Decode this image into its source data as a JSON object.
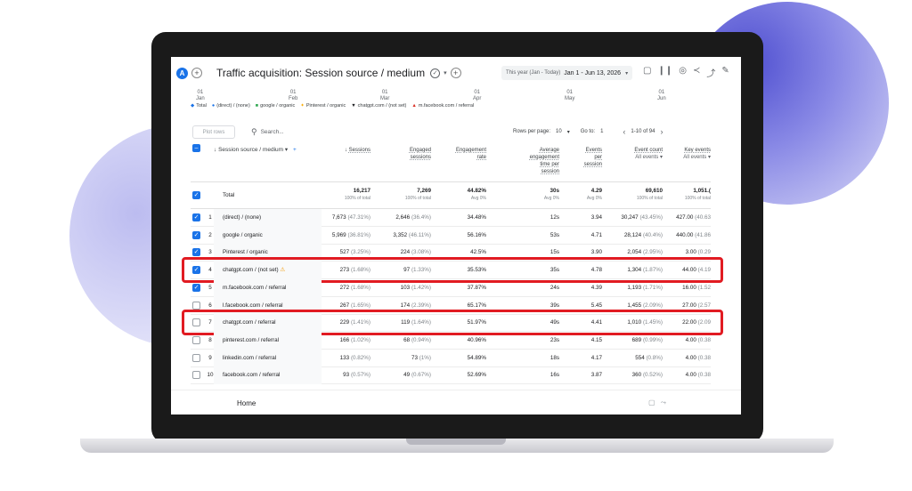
{
  "header": {
    "avatar_letter": "A",
    "add_label": "+",
    "title": "Traffic acquisition: Session source / medium",
    "date_range_label": "This year (Jan - Today)",
    "date_range_value": "Jan 1 - Jun 13, 2026"
  },
  "timeline": [
    {
      "day": "01",
      "month": "Jan"
    },
    {
      "day": "01",
      "month": "Feb"
    },
    {
      "day": "01",
      "month": "Mar"
    },
    {
      "day": "01",
      "month": "Apr"
    },
    {
      "day": "01",
      "month": "May"
    },
    {
      "day": "01",
      "month": "Jun"
    }
  ],
  "legend": [
    {
      "label": "Total",
      "color": "#1a73e8",
      "icon": "diamond"
    },
    {
      "label": "(direct) / (none)",
      "color": "#1a73e8",
      "icon": "dot"
    },
    {
      "label": "google / organic",
      "color": "#34a853",
      "icon": "square"
    },
    {
      "label": "Pinterest / organic",
      "color": "#f9ab00",
      "icon": "star"
    },
    {
      "label": "chatgpt.com / (not set)",
      "color": "#202124",
      "icon": "triangle-down"
    },
    {
      "label": "m.facebook.com / referral",
      "color": "#d93025",
      "icon": "triangle-up"
    }
  ],
  "toolbar": {
    "plot_rows": "Plot rows",
    "search_placeholder": "Search...",
    "rows_per_page_label": "Rows per page:",
    "rows_per_page_value": "10",
    "go_to_label": "Go to:",
    "go_to_value": "1",
    "page_range": "1-10 of 94"
  },
  "columns": {
    "dimension": "Session source / medium",
    "sessions": "Sessions",
    "engaged": [
      "Engaged",
      "sessions"
    ],
    "engagement_rate": [
      "Engagement",
      "rate"
    ],
    "avg_time": [
      "Average",
      "engagement",
      "time per",
      "session"
    ],
    "events_per": [
      "Events",
      "per",
      "session"
    ],
    "event_count": [
      "Event count",
      "All events"
    ],
    "key_events": [
      "Key events",
      "All events"
    ]
  },
  "totals": {
    "label": "Total",
    "sessions": "16,217",
    "sessions_sub": "100% of total",
    "engaged": "7,269",
    "engaged_sub": "100% of total",
    "rate": "44.82%",
    "rate_sub": "Avg 0%",
    "time": "30s",
    "time_sub": "Avg 0%",
    "events_per": "4.29",
    "events_per_sub": "Avg 0%",
    "event_count": "69,610",
    "event_count_sub": "100% of total",
    "key_events": "1,051.(",
    "key_events_sub": "100% of total"
  },
  "rows": [
    {
      "idx": "1",
      "checked": true,
      "source": "(direct) / (none)",
      "sessions": "7,673",
      "sessions_pct": "(47.31%)",
      "engaged": "2,646",
      "engaged_pct": "(36.4%)",
      "rate": "34.48%",
      "time": "12s",
      "events_per": "3.94",
      "event_count": "30,247",
      "event_pct": "(43.45%)",
      "key_events": "427.00",
      "key_pct": "(40.63"
    },
    {
      "idx": "2",
      "checked": true,
      "source": "google / organic",
      "sessions": "5,969",
      "sessions_pct": "(36.81%)",
      "engaged": "3,352",
      "engaged_pct": "(46.11%)",
      "rate": "56.16%",
      "time": "53s",
      "events_per": "4.71",
      "event_count": "28,124",
      "event_pct": "(40.4%)",
      "key_events": "440.00",
      "key_pct": "(41.86"
    },
    {
      "idx": "3",
      "checked": true,
      "source": "Pinterest / organic",
      "sessions": "527",
      "sessions_pct": "(3.25%)",
      "engaged": "224",
      "engaged_pct": "(3.08%)",
      "rate": "42.5%",
      "time": "15s",
      "events_per": "3.90",
      "event_count": "2,054",
      "event_pct": "(2.95%)",
      "key_events": "3.00",
      "key_pct": "(0.29"
    },
    {
      "idx": "4",
      "checked": true,
      "source": "chatgpt.com / (not set)",
      "warn": "⚠",
      "sessions": "273",
      "sessions_pct": "(1.68%)",
      "engaged": "97",
      "engaged_pct": "(1.33%)",
      "rate": "35.53%",
      "time": "35s",
      "events_per": "4.78",
      "event_count": "1,304",
      "event_pct": "(1.87%)",
      "key_events": "44.00",
      "key_pct": "(4.19"
    },
    {
      "idx": "5",
      "checked": true,
      "source": "m.facebook.com / referral",
      "sessions": "272",
      "sessions_pct": "(1.68%)",
      "engaged": "103",
      "engaged_pct": "(1.42%)",
      "rate": "37.87%",
      "time": "24s",
      "events_per": "4.39",
      "event_count": "1,193",
      "event_pct": "(1.71%)",
      "key_events": "16.00",
      "key_pct": "(1.52"
    },
    {
      "idx": "6",
      "checked": false,
      "source": "l.facebook.com / referral",
      "sessions": "267",
      "sessions_pct": "(1.65%)",
      "engaged": "174",
      "engaged_pct": "(2.39%)",
      "rate": "65.17%",
      "time": "39s",
      "events_per": "5.45",
      "event_count": "1,455",
      "event_pct": "(2.09%)",
      "key_events": "27.00",
      "key_pct": "(2.57"
    },
    {
      "idx": "7",
      "checked": false,
      "source": "chatgpt.com / referral",
      "sessions": "229",
      "sessions_pct": "(1.41%)",
      "engaged": "119",
      "engaged_pct": "(1.64%)",
      "rate": "51.97%",
      "time": "49s",
      "events_per": "4.41",
      "event_count": "1,010",
      "event_pct": "(1.45%)",
      "key_events": "22.00",
      "key_pct": "(2.09"
    },
    {
      "idx": "8",
      "checked": false,
      "source": "pinterest.com / referral",
      "sessions": "166",
      "sessions_pct": "(1.02%)",
      "engaged": "68",
      "engaged_pct": "(0.94%)",
      "rate": "40.96%",
      "time": "23s",
      "events_per": "4.15",
      "event_count": "689",
      "event_pct": "(0.99%)",
      "key_events": "4.00",
      "key_pct": "(0.38"
    },
    {
      "idx": "9",
      "checked": false,
      "source": "linkedin.com / referral",
      "sessions": "133",
      "sessions_pct": "(0.82%)",
      "engaged": "73",
      "engaged_pct": "(1%)",
      "rate": "54.89%",
      "time": "18s",
      "events_per": "4.17",
      "event_count": "554",
      "event_pct": "(0.8%)",
      "key_events": "4.00",
      "key_pct": "(0.38"
    },
    {
      "idx": "10",
      "checked": false,
      "source": "facebook.com / referral",
      "sessions": "93",
      "sessions_pct": "(0.57%)",
      "engaged": "49",
      "engaged_pct": "(0.67%)",
      "rate": "52.69%",
      "time": "16s",
      "events_per": "3.87",
      "event_count": "360",
      "event_pct": "(0.52%)",
      "key_events": "4.00",
      "key_pct": "(0.38"
    }
  ],
  "highlighted_rows": [
    "4",
    "7"
  ],
  "highlight_color": "#e11b22",
  "footer": {
    "home_label": "Home"
  }
}
